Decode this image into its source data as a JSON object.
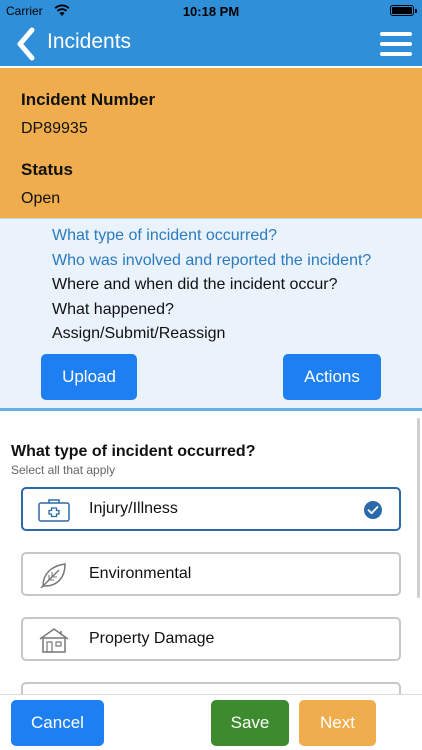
{
  "status_bar": {
    "carrier": "Carrier",
    "time": "10:18 PM"
  },
  "nav": {
    "title": "Incidents"
  },
  "incident": {
    "number_label": "Incident Number",
    "number_value": "DP89935",
    "status_label": "Status",
    "status_value": "Open"
  },
  "steps": [
    {
      "label": "What type of incident occurred?"
    },
    {
      "label": "Who was involved and reported the incident?"
    },
    {
      "label": "Where and when did the incident occur?"
    },
    {
      "label": "What happened?"
    },
    {
      "label": "Assign/Submit/Reassign"
    }
  ],
  "step_buttons": {
    "upload": "Upload",
    "actions": "Actions"
  },
  "section": {
    "title": "What type of incident occurred?",
    "hint": "Select all that apply"
  },
  "options": [
    {
      "label": "Injury/Illness",
      "icon": "first-aid-kit-icon",
      "selected": true
    },
    {
      "label": "Environmental",
      "icon": "leaf-icon",
      "selected": false
    },
    {
      "label": "Property Damage",
      "icon": "house-icon",
      "selected": false
    }
  ],
  "footer": {
    "cancel": "Cancel",
    "save": "Save",
    "next": "Next"
  },
  "colors": {
    "primary": "#2f8fd8",
    "accent_orange": "#f0ad4e",
    "button_blue": "#1e7ff3",
    "save_green": "#3d8b2f",
    "completed_step": "#2b7bbf"
  }
}
